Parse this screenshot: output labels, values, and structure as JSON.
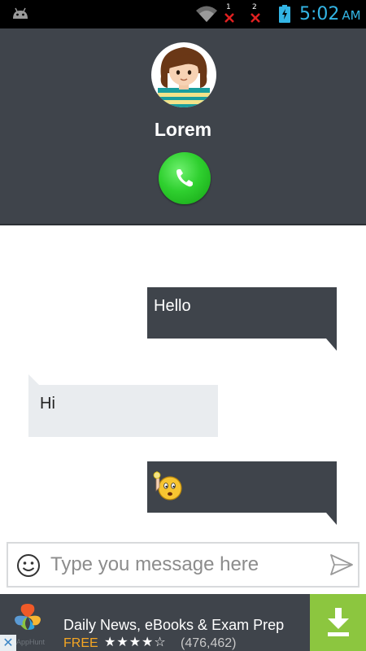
{
  "status_bar": {
    "sim1_label": "1",
    "sim2_label": "2",
    "time": "5:02",
    "ampm": "AM"
  },
  "contact": {
    "name": "Lorem"
  },
  "messages": [
    {
      "direction": "outgoing",
      "text": "Hello"
    },
    {
      "direction": "incoming",
      "text": "Hi"
    },
    {
      "direction": "outgoing",
      "content": "emoji",
      "emoji": "thinking-face"
    }
  ],
  "composer": {
    "placeholder": "Type you message here"
  },
  "ad": {
    "title": "Daily News, eBooks & Exam Prep",
    "price": "FREE",
    "stars": "★★★★☆",
    "rating": 4,
    "reviews": "(476,462)",
    "close": "✕",
    "attribution": "AppHunt"
  },
  "colors": {
    "accent": "#33b5e5",
    "header_bg": "#3f444b",
    "call_green": "#2fd02f",
    "incoming_bubble": "#e9ecef",
    "install_green": "#8cc63f",
    "free_orange": "#f5a623"
  }
}
